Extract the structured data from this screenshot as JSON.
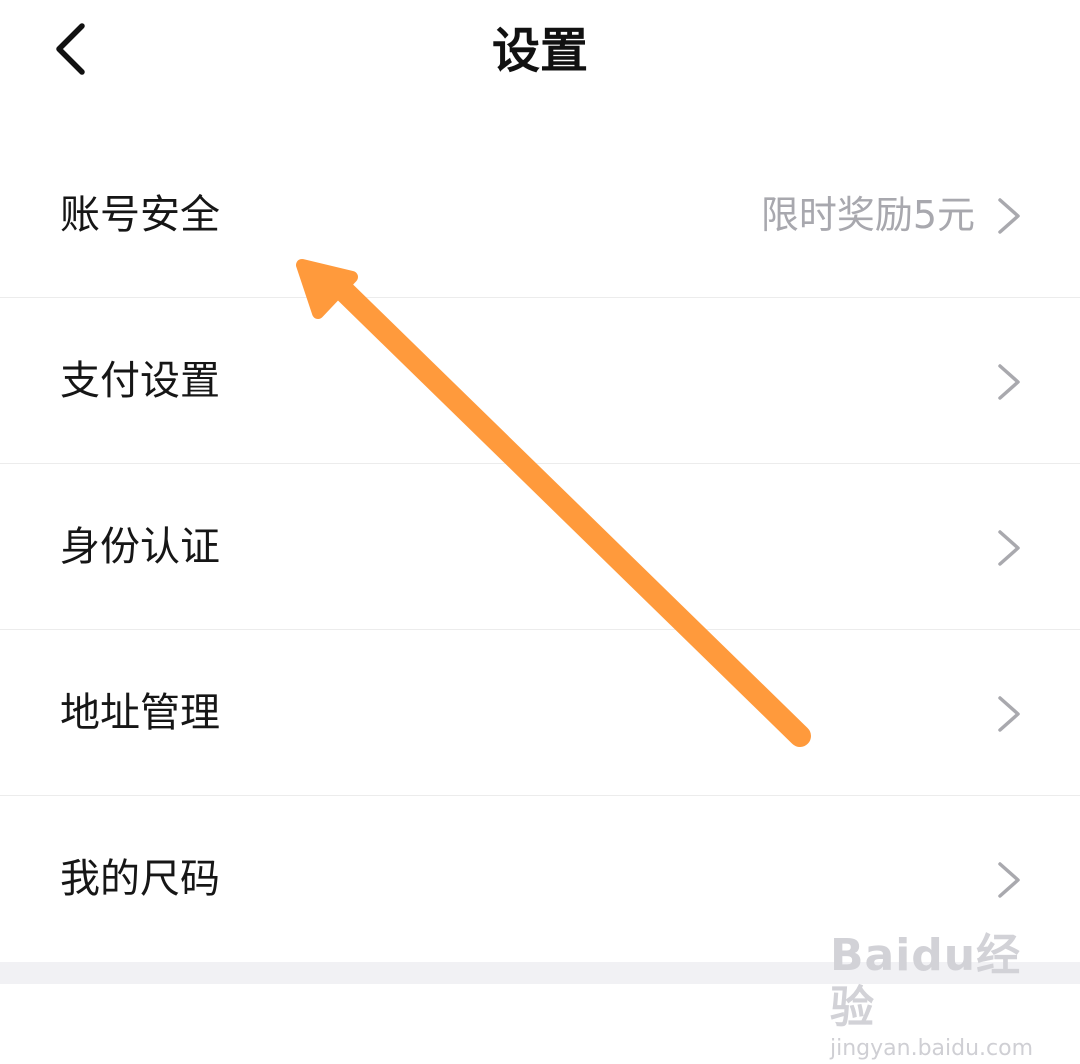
{
  "header": {
    "title": "设置",
    "back_icon": "chevron-left-icon"
  },
  "settings": {
    "items": [
      {
        "label": "账号安全",
        "extra": "限时奖励5元"
      },
      {
        "label": "支付设置",
        "extra": ""
      },
      {
        "label": "身份认证",
        "extra": ""
      },
      {
        "label": "地址管理",
        "extra": ""
      },
      {
        "label": "我的尺码",
        "extra": ""
      }
    ]
  },
  "annotation": {
    "color": "#FF9A3C",
    "icon": "arrow-annotation"
  },
  "watermark": {
    "logo": "Baidu经验",
    "url": "jingyan.baidu.com"
  }
}
